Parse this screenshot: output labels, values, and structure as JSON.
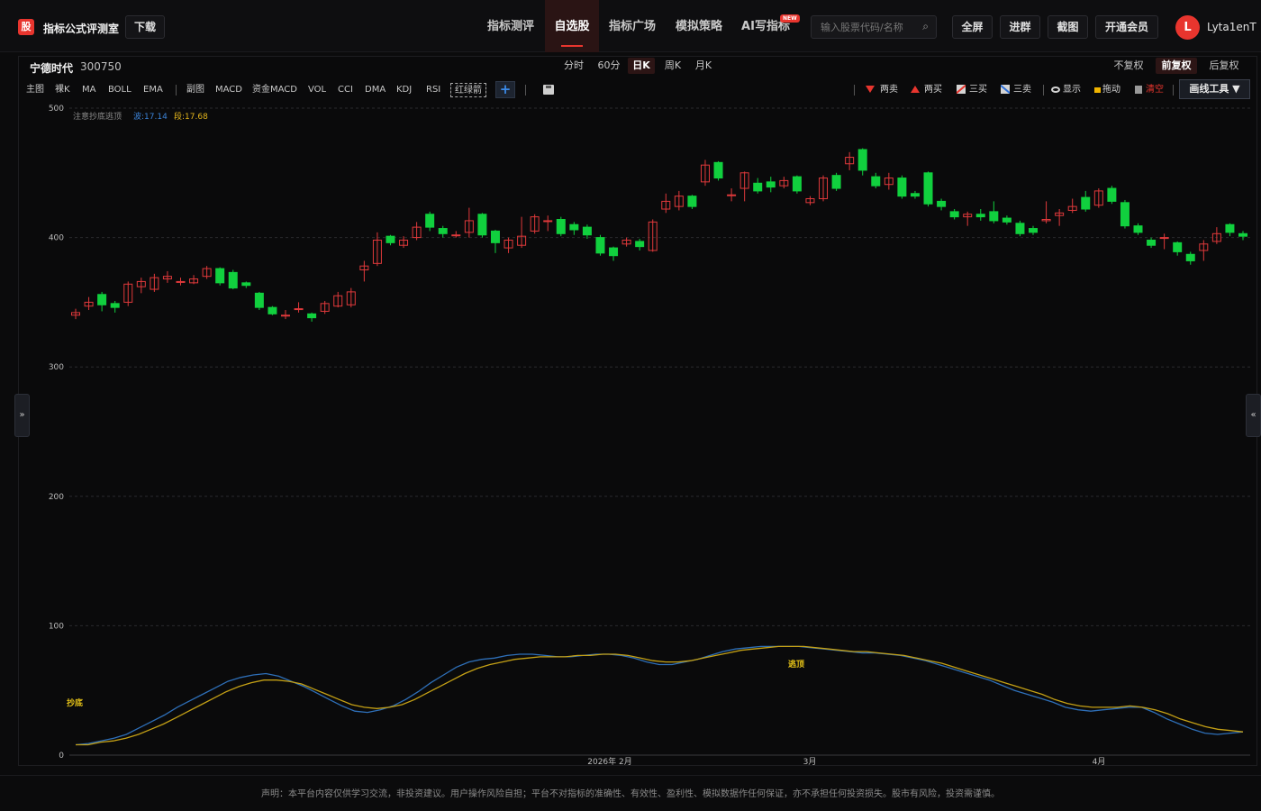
{
  "topbar": {
    "logo_char": "股",
    "brand": "指标公式评测室",
    "download_label": "下载",
    "nav": [
      {
        "label": "指标测评",
        "active": false
      },
      {
        "label": "自选股",
        "active": true
      },
      {
        "label": "指标广场",
        "active": false
      },
      {
        "label": "模拟策略",
        "active": false
      },
      {
        "label": "AI写指标",
        "active": false
      }
    ],
    "new_badge": "NEW",
    "search_placeholder": "输入股票代码/名称",
    "buttons": [
      "全屏",
      "进群",
      "截图",
      "开通会员"
    ],
    "avatar_letter": "L",
    "username": "Lyta1enT"
  },
  "stock": {
    "name": "宁德时代",
    "code": "300750"
  },
  "periods": [
    {
      "label": "分时",
      "active": false
    },
    {
      "label": "60分",
      "active": false
    },
    {
      "label": "日K",
      "active": true
    },
    {
      "label": "周K",
      "active": false
    },
    {
      "label": "月K",
      "active": false
    }
  ],
  "adjust": [
    {
      "label": "不复权",
      "active": false
    },
    {
      "label": "前复权",
      "active": true
    },
    {
      "label": "后复权",
      "active": false
    }
  ],
  "indicators_main": [
    "主图",
    "裸K",
    "MA",
    "BOLL",
    "EMA"
  ],
  "indicators_sub": [
    "副图",
    "MACD",
    "资金MACD",
    "VOL",
    "CCI",
    "DMA",
    "KDJ",
    "RSI",
    "红绿箭"
  ],
  "tools": {
    "sell2": "两卖",
    "buy2": "两买",
    "buy3": "三买",
    "sell3": "三卖",
    "show": "显示",
    "drag": "拖动",
    "clear": "清空",
    "draw": "画线工具 ▼"
  },
  "side_left": "»",
  "side_right": "«",
  "legend": {
    "note": "注意抄底逃顶",
    "wave_label": "波:17.14",
    "seg_label": "段:17.68"
  },
  "annotations": {
    "bottom": "抄底",
    "top": "逃顶"
  },
  "footer": "声明：本平台内容仅供学习交流，非投资建议。用户操作风险自担；平台不对指标的准确性、有效性、盈利性、模拟数据作任何保证，亦不承担任何投资损失。股市有风险，投资需谨慎。",
  "chart_data": {
    "type": "candlestick",
    "y_ticks": [
      0,
      100,
      200,
      300,
      400,
      500
    ],
    "ylim": [
      0,
      500
    ],
    "x_ticks": [
      "2026年 2月",
      "3月",
      "4月"
    ],
    "colors": {
      "up": "#e0393b",
      "down": "#11d03e",
      "wave": "#2e6fb8",
      "seg": "#c4a015"
    },
    "candles": [
      {
        "o": 340,
        "c": 342,
        "h": 345,
        "l": 337
      },
      {
        "o": 347,
        "c": 350,
        "h": 354,
        "l": 344
      },
      {
        "o": 356,
        "c": 348,
        "h": 358,
        "l": 343
      },
      {
        "o": 349,
        "c": 346,
        "h": 351,
        "l": 342
      },
      {
        "o": 350,
        "c": 364,
        "h": 366,
        "l": 347
      },
      {
        "o": 362,
        "c": 366,
        "h": 369,
        "l": 357
      },
      {
        "o": 360,
        "c": 369,
        "h": 372,
        "l": 358
      },
      {
        "o": 368,
        "c": 370,
        "h": 374,
        "l": 365
      },
      {
        "o": 366,
        "c": 366,
        "h": 369,
        "l": 363
      },
      {
        "o": 365,
        "c": 368,
        "h": 371,
        "l": 364
      },
      {
        "o": 370,
        "c": 376,
        "h": 378,
        "l": 368
      },
      {
        "o": 376,
        "c": 365,
        "h": 377,
        "l": 363
      },
      {
        "o": 373,
        "c": 361,
        "h": 375,
        "l": 360
      },
      {
        "o": 365,
        "c": 363,
        "h": 366,
        "l": 361
      },
      {
        "o": 357,
        "c": 346,
        "h": 358,
        "l": 344
      },
      {
        "o": 346,
        "c": 341,
        "h": 347,
        "l": 340
      },
      {
        "o": 340,
        "c": 340,
        "h": 344,
        "l": 337
      },
      {
        "o": 345,
        "c": 345,
        "h": 350,
        "l": 342
      },
      {
        "o": 341,
        "c": 338,
        "h": 342,
        "l": 335
      },
      {
        "o": 343,
        "c": 349,
        "h": 351,
        "l": 341
      },
      {
        "o": 347,
        "c": 355,
        "h": 358,
        "l": 346
      },
      {
        "o": 348,
        "c": 358,
        "h": 361,
        "l": 346
      },
      {
        "o": 375,
        "c": 378,
        "h": 382,
        "l": 366
      },
      {
        "o": 380,
        "c": 398,
        "h": 404,
        "l": 378
      },
      {
        "o": 401,
        "c": 396,
        "h": 402,
        "l": 394
      },
      {
        "o": 394,
        "c": 398,
        "h": 401,
        "l": 392
      },
      {
        "o": 400,
        "c": 408,
        "h": 412,
        "l": 398
      },
      {
        "o": 418,
        "c": 408,
        "h": 420,
        "l": 405
      },
      {
        "o": 407,
        "c": 403,
        "h": 409,
        "l": 400
      },
      {
        "o": 402,
        "c": 402,
        "h": 405,
        "l": 400
      },
      {
        "o": 404,
        "c": 413,
        "h": 423,
        "l": 400
      },
      {
        "o": 418,
        "c": 402,
        "h": 419,
        "l": 400
      },
      {
        "o": 405,
        "c": 396,
        "h": 406,
        "l": 388
      },
      {
        "o": 392,
        "c": 398,
        "h": 400,
        "l": 388
      },
      {
        "o": 394,
        "c": 401,
        "h": 416,
        "l": 392
      },
      {
        "o": 405,
        "c": 416,
        "h": 418,
        "l": 403
      },
      {
        "o": 413,
        "c": 413,
        "h": 417,
        "l": 405
      },
      {
        "o": 414,
        "c": 403,
        "h": 416,
        "l": 401
      },
      {
        "o": 410,
        "c": 406,
        "h": 412,
        "l": 402
      },
      {
        "o": 408,
        "c": 402,
        "h": 410,
        "l": 399
      },
      {
        "o": 400,
        "c": 388,
        "h": 402,
        "l": 386
      },
      {
        "o": 392,
        "c": 386,
        "h": 393,
        "l": 382
      },
      {
        "o": 395,
        "c": 398,
        "h": 400,
        "l": 393
      },
      {
        "o": 397,
        "c": 393,
        "h": 399,
        "l": 390
      },
      {
        "o": 390,
        "c": 412,
        "h": 414,
        "l": 389
      },
      {
        "o": 422,
        "c": 428,
        "h": 434,
        "l": 419
      },
      {
        "o": 424,
        "c": 432,
        "h": 436,
        "l": 421
      },
      {
        "o": 432,
        "c": 424,
        "h": 433,
        "l": 422
      },
      {
        "o": 443,
        "c": 456,
        "h": 460,
        "l": 440
      },
      {
        "o": 458,
        "c": 446,
        "h": 459,
        "l": 444
      },
      {
        "o": 433,
        "c": 433,
        "h": 438,
        "l": 428
      },
      {
        "o": 438,
        "c": 450,
        "h": 451,
        "l": 428
      },
      {
        "o": 442,
        "c": 436,
        "h": 446,
        "l": 434
      },
      {
        "o": 443,
        "c": 439,
        "h": 447,
        "l": 435
      },
      {
        "o": 440,
        "c": 444,
        "h": 447,
        "l": 438
      },
      {
        "o": 447,
        "c": 436,
        "h": 448,
        "l": 434
      },
      {
        "o": 427,
        "c": 430,
        "h": 432,
        "l": 425
      },
      {
        "o": 430,
        "c": 446,
        "h": 448,
        "l": 428
      },
      {
        "o": 448,
        "c": 438,
        "h": 450,
        "l": 436
      },
      {
        "o": 457,
        "c": 462,
        "h": 466,
        "l": 452
      },
      {
        "o": 468,
        "c": 452,
        "h": 469,
        "l": 448
      },
      {
        "o": 447,
        "c": 440,
        "h": 450,
        "l": 438
      },
      {
        "o": 441,
        "c": 446,
        "h": 450,
        "l": 437
      },
      {
        "o": 446,
        "c": 432,
        "h": 448,
        "l": 430
      },
      {
        "o": 434,
        "c": 432,
        "h": 436,
        "l": 430
      },
      {
        "o": 450,
        "c": 426,
        "h": 451,
        "l": 424
      },
      {
        "o": 428,
        "c": 424,
        "h": 430,
        "l": 421
      },
      {
        "o": 420,
        "c": 416,
        "h": 422,
        "l": 414
      },
      {
        "o": 416,
        "c": 418,
        "h": 420,
        "l": 409
      },
      {
        "o": 418,
        "c": 416,
        "h": 422,
        "l": 413
      },
      {
        "o": 420,
        "c": 413,
        "h": 428,
        "l": 411
      },
      {
        "o": 415,
        "c": 412,
        "h": 417,
        "l": 410
      },
      {
        "o": 411,
        "c": 403,
        "h": 413,
        "l": 401
      },
      {
        "o": 407,
        "c": 404,
        "h": 409,
        "l": 402
      },
      {
        "o": 413,
        "c": 414,
        "h": 428,
        "l": 411
      },
      {
        "o": 417,
        "c": 419,
        "h": 422,
        "l": 409
      },
      {
        "o": 421,
        "c": 424,
        "h": 430,
        "l": 419
      },
      {
        "o": 431,
        "c": 422,
        "h": 436,
        "l": 420
      },
      {
        "o": 425,
        "c": 436,
        "h": 438,
        "l": 423
      },
      {
        "o": 438,
        "c": 428,
        "h": 440,
        "l": 426
      },
      {
        "o": 427,
        "c": 409,
        "h": 429,
        "l": 407
      },
      {
        "o": 409,
        "c": 404,
        "h": 411,
        "l": 402
      },
      {
        "o": 398,
        "c": 394,
        "h": 400,
        "l": 392
      },
      {
        "o": 400,
        "c": 400,
        "h": 403,
        "l": 391
      },
      {
        "o": 396,
        "c": 389,
        "h": 397,
        "l": 386
      },
      {
        "o": 387,
        "c": 382,
        "h": 389,
        "l": 379
      },
      {
        "o": 390,
        "c": 395,
        "h": 398,
        "l": 382
      },
      {
        "o": 397,
        "c": 403,
        "h": 408,
        "l": 395
      },
      {
        "o": 410,
        "c": 404,
        "h": 411,
        "l": 401
      },
      {
        "o": 403,
        "c": 401,
        "h": 405,
        "l": 398
      }
    ],
    "series": [
      {
        "name": "波",
        "values": [
          8,
          9,
          11,
          13,
          16,
          21,
          26,
          31,
          37,
          42,
          47,
          52,
          57,
          60,
          62,
          63,
          61,
          57,
          53,
          48,
          43,
          38,
          34,
          33,
          35,
          38,
          43,
          49,
          56,
          62,
          68,
          72,
          74,
          75,
          77,
          78,
          78,
          77,
          76,
          76,
          77,
          78,
          78,
          77,
          75,
          72,
          70,
          70,
          72,
          74,
          77,
          80,
          82,
          83,
          84,
          84,
          84,
          84,
          83,
          82,
          81,
          80,
          79,
          79,
          78,
          77,
          75,
          73,
          70,
          67,
          64,
          61,
          58,
          54,
          50,
          47,
          44,
          41,
          37,
          35,
          34,
          35,
          36,
          37,
          37,
          33,
          28,
          24,
          20,
          17,
          16,
          17,
          18
        ]
      },
      {
        "name": "段",
        "values": [
          8,
          8,
          10,
          11,
          13,
          16,
          20,
          24,
          29,
          34,
          39,
          44,
          49,
          53,
          56,
          58,
          58,
          57,
          55,
          51,
          47,
          43,
          39,
          37,
          36,
          37,
          39,
          43,
          48,
          53,
          58,
          63,
          67,
          70,
          72,
          74,
          75,
          76,
          76,
          76,
          77,
          77,
          78,
          78,
          77,
          75,
          73,
          72,
          72,
          73,
          75,
          77,
          79,
          81,
          82,
          83,
          84,
          84,
          84,
          83,
          82,
          81,
          80,
          80,
          79,
          78,
          77,
          75,
          73,
          71,
          68,
          65,
          62,
          59,
          56,
          53,
          50,
          47,
          43,
          40,
          38,
          37,
          37,
          37,
          38,
          37,
          35,
          32,
          28,
          25,
          22,
          20,
          19,
          18
        ]
      }
    ]
  }
}
